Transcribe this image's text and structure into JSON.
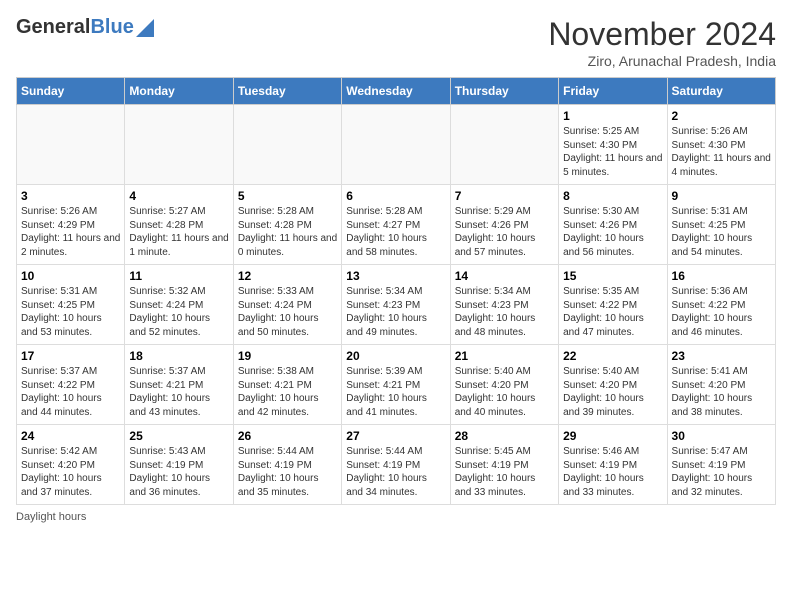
{
  "header": {
    "logo_general": "General",
    "logo_blue": "Blue",
    "month_title": "November 2024",
    "subtitle": "Ziro, Arunachal Pradesh, India"
  },
  "days_of_week": [
    "Sunday",
    "Monday",
    "Tuesday",
    "Wednesday",
    "Thursday",
    "Friday",
    "Saturday"
  ],
  "weeks": [
    {
      "cells": [
        {
          "day": "",
          "info": ""
        },
        {
          "day": "",
          "info": ""
        },
        {
          "day": "",
          "info": ""
        },
        {
          "day": "",
          "info": ""
        },
        {
          "day": "",
          "info": ""
        },
        {
          "day": "1",
          "info": "Sunrise: 5:25 AM\nSunset: 4:30 PM\nDaylight: 11 hours and 5 minutes."
        },
        {
          "day": "2",
          "info": "Sunrise: 5:26 AM\nSunset: 4:30 PM\nDaylight: 11 hours and 4 minutes."
        }
      ]
    },
    {
      "cells": [
        {
          "day": "3",
          "info": "Sunrise: 5:26 AM\nSunset: 4:29 PM\nDaylight: 11 hours and 2 minutes."
        },
        {
          "day": "4",
          "info": "Sunrise: 5:27 AM\nSunset: 4:28 PM\nDaylight: 11 hours and 1 minute."
        },
        {
          "day": "5",
          "info": "Sunrise: 5:28 AM\nSunset: 4:28 PM\nDaylight: 11 hours and 0 minutes."
        },
        {
          "day": "6",
          "info": "Sunrise: 5:28 AM\nSunset: 4:27 PM\nDaylight: 10 hours and 58 minutes."
        },
        {
          "day": "7",
          "info": "Sunrise: 5:29 AM\nSunset: 4:26 PM\nDaylight: 10 hours and 57 minutes."
        },
        {
          "day": "8",
          "info": "Sunrise: 5:30 AM\nSunset: 4:26 PM\nDaylight: 10 hours and 56 minutes."
        },
        {
          "day": "9",
          "info": "Sunrise: 5:31 AM\nSunset: 4:25 PM\nDaylight: 10 hours and 54 minutes."
        }
      ]
    },
    {
      "cells": [
        {
          "day": "10",
          "info": "Sunrise: 5:31 AM\nSunset: 4:25 PM\nDaylight: 10 hours and 53 minutes."
        },
        {
          "day": "11",
          "info": "Sunrise: 5:32 AM\nSunset: 4:24 PM\nDaylight: 10 hours and 52 minutes."
        },
        {
          "day": "12",
          "info": "Sunrise: 5:33 AM\nSunset: 4:24 PM\nDaylight: 10 hours and 50 minutes."
        },
        {
          "day": "13",
          "info": "Sunrise: 5:34 AM\nSunset: 4:23 PM\nDaylight: 10 hours and 49 minutes."
        },
        {
          "day": "14",
          "info": "Sunrise: 5:34 AM\nSunset: 4:23 PM\nDaylight: 10 hours and 48 minutes."
        },
        {
          "day": "15",
          "info": "Sunrise: 5:35 AM\nSunset: 4:22 PM\nDaylight: 10 hours and 47 minutes."
        },
        {
          "day": "16",
          "info": "Sunrise: 5:36 AM\nSunset: 4:22 PM\nDaylight: 10 hours and 46 minutes."
        }
      ]
    },
    {
      "cells": [
        {
          "day": "17",
          "info": "Sunrise: 5:37 AM\nSunset: 4:22 PM\nDaylight: 10 hours and 44 minutes."
        },
        {
          "day": "18",
          "info": "Sunrise: 5:37 AM\nSunset: 4:21 PM\nDaylight: 10 hours and 43 minutes."
        },
        {
          "day": "19",
          "info": "Sunrise: 5:38 AM\nSunset: 4:21 PM\nDaylight: 10 hours and 42 minutes."
        },
        {
          "day": "20",
          "info": "Sunrise: 5:39 AM\nSunset: 4:21 PM\nDaylight: 10 hours and 41 minutes."
        },
        {
          "day": "21",
          "info": "Sunrise: 5:40 AM\nSunset: 4:20 PM\nDaylight: 10 hours and 40 minutes."
        },
        {
          "day": "22",
          "info": "Sunrise: 5:40 AM\nSunset: 4:20 PM\nDaylight: 10 hours and 39 minutes."
        },
        {
          "day": "23",
          "info": "Sunrise: 5:41 AM\nSunset: 4:20 PM\nDaylight: 10 hours and 38 minutes."
        }
      ]
    },
    {
      "cells": [
        {
          "day": "24",
          "info": "Sunrise: 5:42 AM\nSunset: 4:20 PM\nDaylight: 10 hours and 37 minutes."
        },
        {
          "day": "25",
          "info": "Sunrise: 5:43 AM\nSunset: 4:19 PM\nDaylight: 10 hours and 36 minutes."
        },
        {
          "day": "26",
          "info": "Sunrise: 5:44 AM\nSunset: 4:19 PM\nDaylight: 10 hours and 35 minutes."
        },
        {
          "day": "27",
          "info": "Sunrise: 5:44 AM\nSunset: 4:19 PM\nDaylight: 10 hours and 34 minutes."
        },
        {
          "day": "28",
          "info": "Sunrise: 5:45 AM\nSunset: 4:19 PM\nDaylight: 10 hours and 33 minutes."
        },
        {
          "day": "29",
          "info": "Sunrise: 5:46 AM\nSunset: 4:19 PM\nDaylight: 10 hours and 33 minutes."
        },
        {
          "day": "30",
          "info": "Sunrise: 5:47 AM\nSunset: 4:19 PM\nDaylight: 10 hours and 32 minutes."
        }
      ]
    }
  ],
  "footer": {
    "note": "Daylight hours"
  }
}
